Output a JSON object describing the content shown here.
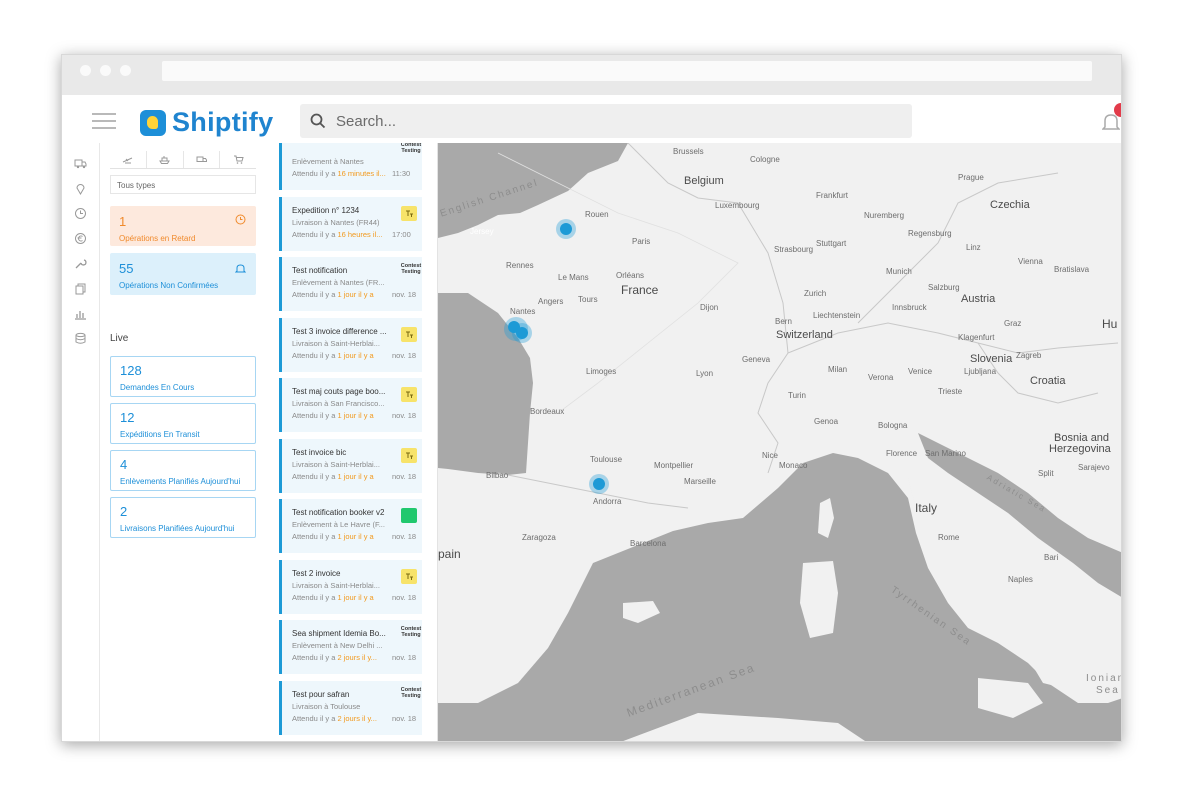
{
  "app": {
    "name": "Shiptify"
  },
  "search": {
    "placeholder": "Search..."
  },
  "filters": {
    "type_select": "Tous types",
    "late": {
      "count": "1",
      "label": "Opérations en Retard"
    },
    "unconfirmed": {
      "count": "55",
      "label": "Opérations Non Confirmées"
    }
  },
  "live": {
    "title": "Live",
    "cards": [
      {
        "count": "128",
        "label": "Demandes En Cours"
      },
      {
        "count": "12",
        "label": "Expéditions En Transit"
      },
      {
        "count": "4",
        "label": "Enlèvements Planifiés Aujourd'hui"
      },
      {
        "count": "2",
        "label": "Livraisons Planifiées Aujourd'hui"
      }
    ]
  },
  "shipments": [
    {
      "title": "",
      "sub": "Enlèvement à Nantes",
      "wait_prefix": "Attendu il y a ",
      "wait": "16 minutes il...",
      "wait_suffix": "",
      "date": "11:30",
      "tag": "Contest Testing"
    },
    {
      "title": "Expedition n° 1234",
      "sub": "Livraison à Nantes (FR44)",
      "wait_prefix": "Attendu il y a ",
      "wait": "16 heures il...",
      "wait_suffix": "",
      "date": "17:00",
      "tag": "yellow"
    },
    {
      "title": "Test notification",
      "sub": "Enlèvement à Nantes (FR...",
      "wait_prefix": "Attendu il y a ",
      "wait": "1 jour il y a",
      "wait_suffix": "",
      "date": "nov. 18",
      "tag": "Contest Testing"
    },
    {
      "title": "Test 3 invoice difference ...",
      "sub": "Livraison à Saint-Herblai...",
      "wait_prefix": "Attendu il y a ",
      "wait": "1 jour il y a",
      "wait_suffix": "",
      "date": "nov. 18",
      "tag": "yellow"
    },
    {
      "title": "Test maj couts page boo...",
      "sub": "Livraison à San Francisco...",
      "wait_prefix": "Attendu il y a ",
      "wait": "1 jour il y a",
      "wait_suffix": "",
      "date": "nov. 18",
      "tag": "yellow"
    },
    {
      "title": "Test invoice bic",
      "sub": "Livraison à Saint-Herblai...",
      "wait_prefix": "Attendu il y a ",
      "wait": "1 jour il y a",
      "wait_suffix": "",
      "date": "nov. 18",
      "tag": "yellow"
    },
    {
      "title": "Test notification booker v2",
      "sub": "Enlèvement à Le Havre (F...",
      "wait_prefix": "Attendu il y a ",
      "wait": "1 jour il y a",
      "wait_suffix": "",
      "date": "nov. 18",
      "tag": "green"
    },
    {
      "title": "Test 2 invoice",
      "sub": "Livraison à Saint-Herblai...",
      "wait_prefix": "Attendu il y a ",
      "wait": "1 jour il y a",
      "wait_suffix": "",
      "date": "nov. 18",
      "tag": "yellow"
    },
    {
      "title": "Sea shipment Idemia Bo...",
      "sub": "Enlèvement à New Delhi ...",
      "wait_prefix": "Attendu il y a ",
      "wait": "2 jours il y...",
      "wait_suffix": "",
      "date": "nov. 18",
      "tag": "Contest Testing"
    },
    {
      "title": "Test pour safran",
      "sub": "Livraison à Toulouse",
      "wait_prefix": "Attendu il y a ",
      "wait": "2 jours il y...",
      "wait_suffix": "",
      "date": "nov. 18",
      "tag": "Contest Testing"
    }
  ],
  "map": {
    "labels": {
      "belgium": "Belgium",
      "luxembourg": "Luxembourg",
      "france": "France",
      "switzerland": "Switzerland",
      "liechtenstein": "Liechtenstein",
      "austria": "Austria",
      "czechia": "Czechia",
      "slovenia": "Slovenia",
      "croatia": "Croatia",
      "bosnia": "Bosnia and",
      "herzegovina": "Herzegovina",
      "san_marino": "San Marino",
      "italy": "Italy",
      "monaco": "Monaco",
      "andorra": "Andorra",
      "spain": "pain",
      "hu": "Hu",
      "english_channel": "English Channel",
      "mediterranean": "Mediterranean Sea",
      "tyrrhenian": "Tyrrhenian Sea",
      "adriatic": "Adriatic Sea",
      "ionian": "Ionian",
      "ionian2": "Sea",
      "jersey": "Jersey",
      "paris": "Paris",
      "rouen": "Rouen",
      "brussels": "Brussels",
      "cologne": "Cologne",
      "frankfurt": "Frankfurt",
      "nuremberg": "Nuremberg",
      "stuttgart": "Stuttgart",
      "munich": "Munich",
      "strasbourg": "Strasbourg",
      "nantes": "Nantes",
      "bordeaux": "Bordeaux",
      "toulouse": "Toulouse",
      "lyon": "Lyon",
      "marseille": "Marseille",
      "nice": "Nice",
      "milan": "Milan",
      "turin": "Turin",
      "genoa": "Genoa",
      "bologna": "Bologna",
      "florence": "Florence",
      "venice": "Venice",
      "verona": "Verona",
      "rome": "Rome",
      "naples": "Naples",
      "bari": "Bari",
      "geneva": "Geneva",
      "bern": "Bern",
      "zurich": "Zurich",
      "dijon": "Dijon",
      "limoges": "Limoges",
      "montpellier": "Montpellier",
      "barcelona": "Barcelona",
      "zaragoza": "Zaragoza",
      "bilbao": "Bilbao",
      "orleans": "Orléans",
      "tours": "Tours",
      "angers": "Angers",
      "rennes": "Rennes",
      "lemans": "Le Mans",
      "innsbruck": "Innsbruck",
      "salzburg": "Salzburg",
      "vienna": "Vienna",
      "graz": "Graz",
      "ljubljana": "Ljubljana",
      "zagreb": "Zagreb",
      "sarajevo": "Sarajevo",
      "split": "Split",
      "trieste": "Trieste",
      "bratislava": "Bratislava",
      "prague": "Prague",
      "linz": "Linz",
      "regensburg": "Regensburg",
      "klagenfurt": "Klagenfurt"
    },
    "marker_cities": [
      "Rouen",
      "Nantes",
      "Toulouse"
    ]
  },
  "colors": {
    "brand": "#1f84cf",
    "accent": "#1d9ad6",
    "late": "#f08a2c",
    "late_bg": "#fde9dd",
    "unconfirmed_bg": "#dcf0fb",
    "sea": "#a9a9a9",
    "land": "#f1f1f1"
  }
}
